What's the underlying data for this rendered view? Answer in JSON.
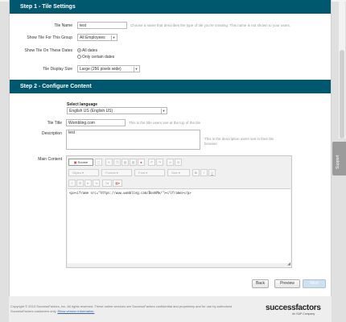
{
  "step1": {
    "title": "Step 1 - Tile Settings",
    "tile_name_label": "Tile Name",
    "tile_name_value": "test",
    "tile_name_hint": "Choose a name that describes the type of tile you're creating. This name is not shown to your users.",
    "group_label": "Show Tile For This Group",
    "group_value": "All Employees",
    "dates_label": "Show Tile On These Dates",
    "dates_option_all": "All dates",
    "dates_option_certain": "Only certain dates",
    "display_size_label": "Tile Display Size",
    "display_size_value": "Large (256 pixels wide)"
  },
  "step2": {
    "title": "Step 2 - Configure Content",
    "language_label": "Select language",
    "language_value": "English US (English US)",
    "tile_title_label": "Tile Title",
    "tile_title_value": "Wombling.com",
    "tile_title_hint": "This is the title users see at the top of the tile",
    "description_label": "Description",
    "description_value": "test",
    "description_hint": "This is the description users see in their tile browser",
    "main_content_label": "Main Content",
    "editor": {
      "source_label": "Source",
      "styles_label": "Styles",
      "format_label": "Format",
      "font_label": "Font",
      "size_label": "Size",
      "bold_label": "B",
      "italic_label": "I",
      "underline_label": "U",
      "content": "<p><iframe src=\"https://www.wombling.com/BookMe/\"></iframe></p>"
    }
  },
  "buttons": {
    "back": "Back",
    "preview": "Preview",
    "next": "Next"
  },
  "footer": {
    "copyright": "Copyright © 2013 SuccessFactors, Inc. All rights reserved. These online services are SuccessFactors confidential and proprietary and for use by authorized SuccessFactors customers only.",
    "version_link": "Show version information.",
    "logo": "successfactors",
    "logo_sub": "An SAP Company"
  },
  "feedback_tab": "Support",
  "colors": {
    "header_bar": "#00586f",
    "background": "#e0e0e0"
  }
}
